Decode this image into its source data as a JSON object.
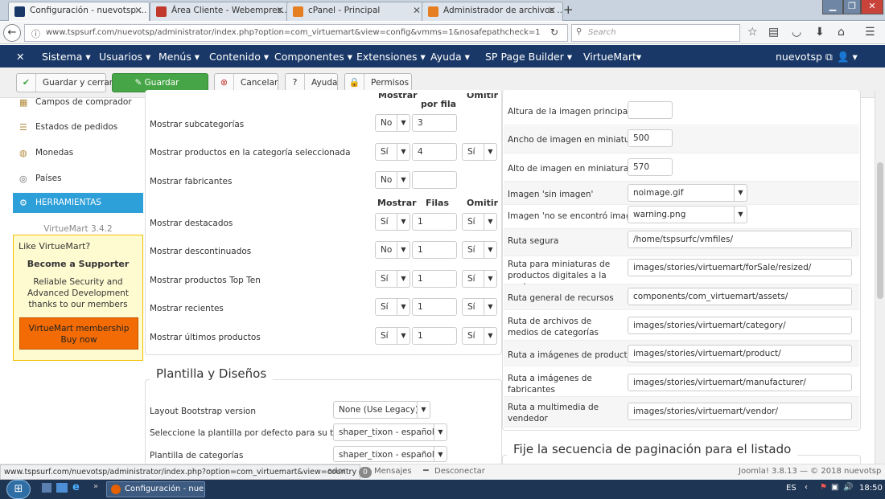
{
  "browser": {
    "tabs": [
      {
        "title": "Configuración - nuevotsp ...",
        "color": "#1a3867"
      },
      {
        "title": "Área Cliente - Webempres...",
        "color": "#c0392b"
      },
      {
        "title": "cPanel - Principal",
        "color": "#e67e22"
      },
      {
        "title": "Administrador de archivos ...",
        "color": "#e67e22"
      }
    ],
    "url": "www.tspsurf.com/nuevotsp/administrator/index.php?option=com_virtuemart&view=config&vmms=1&nosafepathcheck=1",
    "search_placeholder": "Search"
  },
  "joomla_menu": {
    "logo": "✕",
    "items": [
      "Sistema ▾",
      "Usuarios ▾",
      "Menús ▾",
      "Contenido ▾",
      "Componentes ▾",
      "Extensiones ▾",
      "Ayuda ▾",
      "SP Page Builder ▾",
      "VirtueMart▾"
    ],
    "user": "nuevotsp ⧉",
    "user_icon": "👤 ▾"
  },
  "toolbar": {
    "save_close": "Guardar y cerrar",
    "save": "Guardar",
    "cancel": "Cancelar",
    "help": "Ayuda",
    "permissions": "Permisos"
  },
  "sidebar": {
    "items": [
      "Campos de comprador",
      "Estados de pedidos",
      "Monedas",
      "Países",
      "HERRAMIENTAS"
    ],
    "version": "VirtueMart 3.4.2",
    "promo": {
      "title": "Like VirtueMart?",
      "headline": "Become a Supporter",
      "body": "Reliable Security and Advanced Development thanks to our members",
      "button": "VirtueMart membership Buy now"
    }
  },
  "left_panel": {
    "col_headers_top": [
      "Mostrar",
      "por fila",
      "Omitir"
    ],
    "col_headers_mid": [
      "Mostrar",
      "Filas",
      "Omitir"
    ],
    "rows": [
      {
        "label": "Mostrar subcategorías",
        "show": "No",
        "count": "3",
        "skip": ""
      },
      {
        "label": "Mostrar productos en la categoría seleccionada",
        "show": "Sí",
        "count": "4",
        "skip": "Sí"
      },
      {
        "label": "Mostrar fabricantes",
        "show": "No",
        "count": "",
        "skip": ""
      },
      {
        "label": "Mostrar destacados",
        "show": "Sí",
        "count": "1",
        "skip": "Sí"
      },
      {
        "label": "Mostrar descontinuados",
        "show": "No",
        "count": "1",
        "skip": "Sí"
      },
      {
        "label": "Mostrar productos Top Ten",
        "show": "Sí",
        "count": "1",
        "skip": "Sí"
      },
      {
        "label": "Mostrar recientes",
        "show": "Sí",
        "count": "1",
        "skip": "Sí"
      },
      {
        "label": "Mostrar últimos productos",
        "show": "Sí",
        "count": "1",
        "skip": "Sí"
      }
    ]
  },
  "templates": {
    "title": "Plantilla y Diseños",
    "rows": [
      {
        "label": "Layout Bootstrap version",
        "value": "None (Use Legacy)"
      },
      {
        "label": "Seleccione la plantilla por defecto para su tienda",
        "value": "shaper_tixon - español"
      },
      {
        "label": "Plantilla de categorías",
        "value": "shaper_tixon - español"
      }
    ]
  },
  "right_panel": {
    "rows": [
      {
        "label": "Altura de la imagen principal",
        "value": ""
      },
      {
        "label": "Ancho de imagen en miniatura",
        "value": "500"
      },
      {
        "label": "Alto de imagen en miniatura",
        "value": "570"
      },
      {
        "label": "Imagen 'sin imagen'",
        "value": "noimage.gif"
      },
      {
        "label": "Imagen 'no se encontró imagen'",
        "value": "warning.png"
      },
      {
        "label": "Ruta segura",
        "value": "/home/tspsurfc/vmfiles/"
      },
      {
        "label": "Ruta para miniaturas de productos digitales a la venta",
        "value": "images/stories/virtuemart/forSale/resized/"
      },
      {
        "label": "Ruta general de recursos",
        "value": "components/com_virtuemart/assets/"
      },
      {
        "label": "Ruta de archivos de medios de categorías",
        "value": "images/stories/virtuemart/category/"
      },
      {
        "label": "Ruta a imágenes de productos",
        "value": "images/stories/virtuemart/product/"
      },
      {
        "label": "Ruta a imágenes de fabricantes",
        "value": "images/stories/virtuemart/manufacturer/"
      },
      {
        "label": "Ruta a multimedia de vendedor",
        "value": "images/stories/virtuemart/vendor/"
      }
    ],
    "section_title": "Fije la secuencia de paginación para el listado"
  },
  "statusbar": {
    "link": "www.tspsurf.com/nuevotsp/administrator/index.php?option=com_virtuemart&view=country",
    "frag": "ador",
    "messages_count": "0",
    "messages": "Mensajes",
    "logout": "Desconectar",
    "version": "Joomla! 3.8.13 — © 2018 nuevotsp"
  },
  "taskbar": {
    "window": "Configuración - nue...",
    "lang": "ES",
    "time": "18:50"
  },
  "colors": {
    "joomla_nav": "#1a3867",
    "save_green": "#46a546",
    "sidebar_active": "#2d9fd9",
    "promo_bg": "#fffbd1",
    "promo_border": "#f2c000",
    "promo_button": "#f26b04"
  }
}
